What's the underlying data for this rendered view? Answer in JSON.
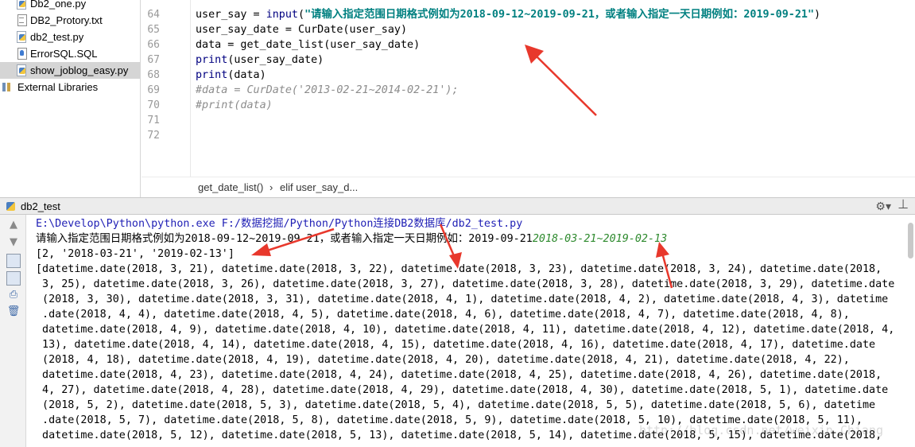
{
  "project_tree": {
    "items": [
      {
        "label": "Db2_one.py",
        "icon": "python-file-icon"
      },
      {
        "label": "DB2_Protory.txt",
        "icon": "text-file-icon"
      },
      {
        "label": "db2_test.py",
        "icon": "python-file-icon"
      },
      {
        "label": "ErrorSQL.SQL",
        "icon": "sql-file-icon"
      },
      {
        "label": "show_joblog_easy.py",
        "icon": "python-file-icon",
        "selected": true
      },
      {
        "label": "External Libraries",
        "icon": "library-icon"
      }
    ]
  },
  "editor": {
    "line_numbers": [
      "64",
      "65",
      "66",
      "67",
      "68",
      "69",
      "70",
      "71",
      "72"
    ],
    "lines": {
      "l64": {
        "a": "user_say = ",
        "b": "input",
        "c": "(",
        "d": "\"请输入指定范围日期格式例如为2018-09-12~2019-09-21，或者输入指定一天日期例如：2019-09-21\"",
        "e": ")"
      },
      "l65": "user_say_date = CurDate(user_say)",
      "l66": "data = get_date_list(user_say_date)",
      "l67": {
        "kw": "print",
        "rest": "(user_say_date)"
      },
      "l68": {
        "kw": "print",
        "rest": "(data)"
      },
      "l69": "#data = CurDate('2013-02-21~2014-02-21');",
      "l70": "#print(data)"
    },
    "breadcrumbs": [
      "get_date_list()",
      "›",
      "elif user_say_d..."
    ]
  },
  "run_panel": {
    "tab_title": "db2_test",
    "command": "E:\\Develop\\Python\\python.exe F:/数据挖掘/Python/Python连接DB2数据库/db2_test.py",
    "prompt": "请输入指定范围日期格式例如为2018-09-12~2019-09-21，或者输入指定一天日期例如：2019-09-21",
    "user_input": "2018-03-21~2019-02-13",
    "result_list": "[2, '2018-03-21', '2019-02-13']",
    "output_lines": [
      "[datetime.date(2018, 3, 21), datetime.date(2018, 3, 22), datetime.date(2018, 3, 23), datetime.date(2018, 3, 24), datetime.date(2018,",
      " 3, 25), datetime.date(2018, 3, 26), datetime.date(2018, 3, 27), datetime.date(2018, 3, 28), datetime.date(2018, 3, 29), datetime.date",
      " (2018, 3, 30), datetime.date(2018, 3, 31), datetime.date(2018, 4, 1), datetime.date(2018, 4, 2), datetime.date(2018, 4, 3), datetime",
      " .date(2018, 4, 4), datetime.date(2018, 4, 5), datetime.date(2018, 4, 6), datetime.date(2018, 4, 7), datetime.date(2018, 4, 8),",
      " datetime.date(2018, 4, 9), datetime.date(2018, 4, 10), datetime.date(2018, 4, 11), datetime.date(2018, 4, 12), datetime.date(2018, 4,",
      " 13), datetime.date(2018, 4, 14), datetime.date(2018, 4, 15), datetime.date(2018, 4, 16), datetime.date(2018, 4, 17), datetime.date",
      " (2018, 4, 18), datetime.date(2018, 4, 19), datetime.date(2018, 4, 20), datetime.date(2018, 4, 21), datetime.date(2018, 4, 22),",
      " datetime.date(2018, 4, 23), datetime.date(2018, 4, 24), datetime.date(2018, 4, 25), datetime.date(2018, 4, 26), datetime.date(2018,",
      " 4, 27), datetime.date(2018, 4, 28), datetime.date(2018, 4, 29), datetime.date(2018, 4, 30), datetime.date(2018, 5, 1), datetime.date",
      " (2018, 5, 2), datetime.date(2018, 5, 3), datetime.date(2018, 5, 4), datetime.date(2018, 5, 5), datetime.date(2018, 5, 6), datetime",
      " .date(2018, 5, 7), datetime.date(2018, 5, 8), datetime.date(2018, 5, 9), datetime.date(2018, 5, 10), datetime.date(2018, 5, 11),",
      " datetime.date(2018, 5, 12), datetime.date(2018, 5, 13), datetime.date(2018, 5, 14), datetime.date(2018, 5, 15), datetime.date(2018,"
    ],
    "watermark": "http://blog.csdn.net/weixin_Chiang"
  },
  "colors": {
    "annotation_arrow": "#e8382c",
    "string_literal": "#008080",
    "keyword": "#000080",
    "user_input": "#2e8a2e",
    "command_text": "#1f1fb5"
  }
}
